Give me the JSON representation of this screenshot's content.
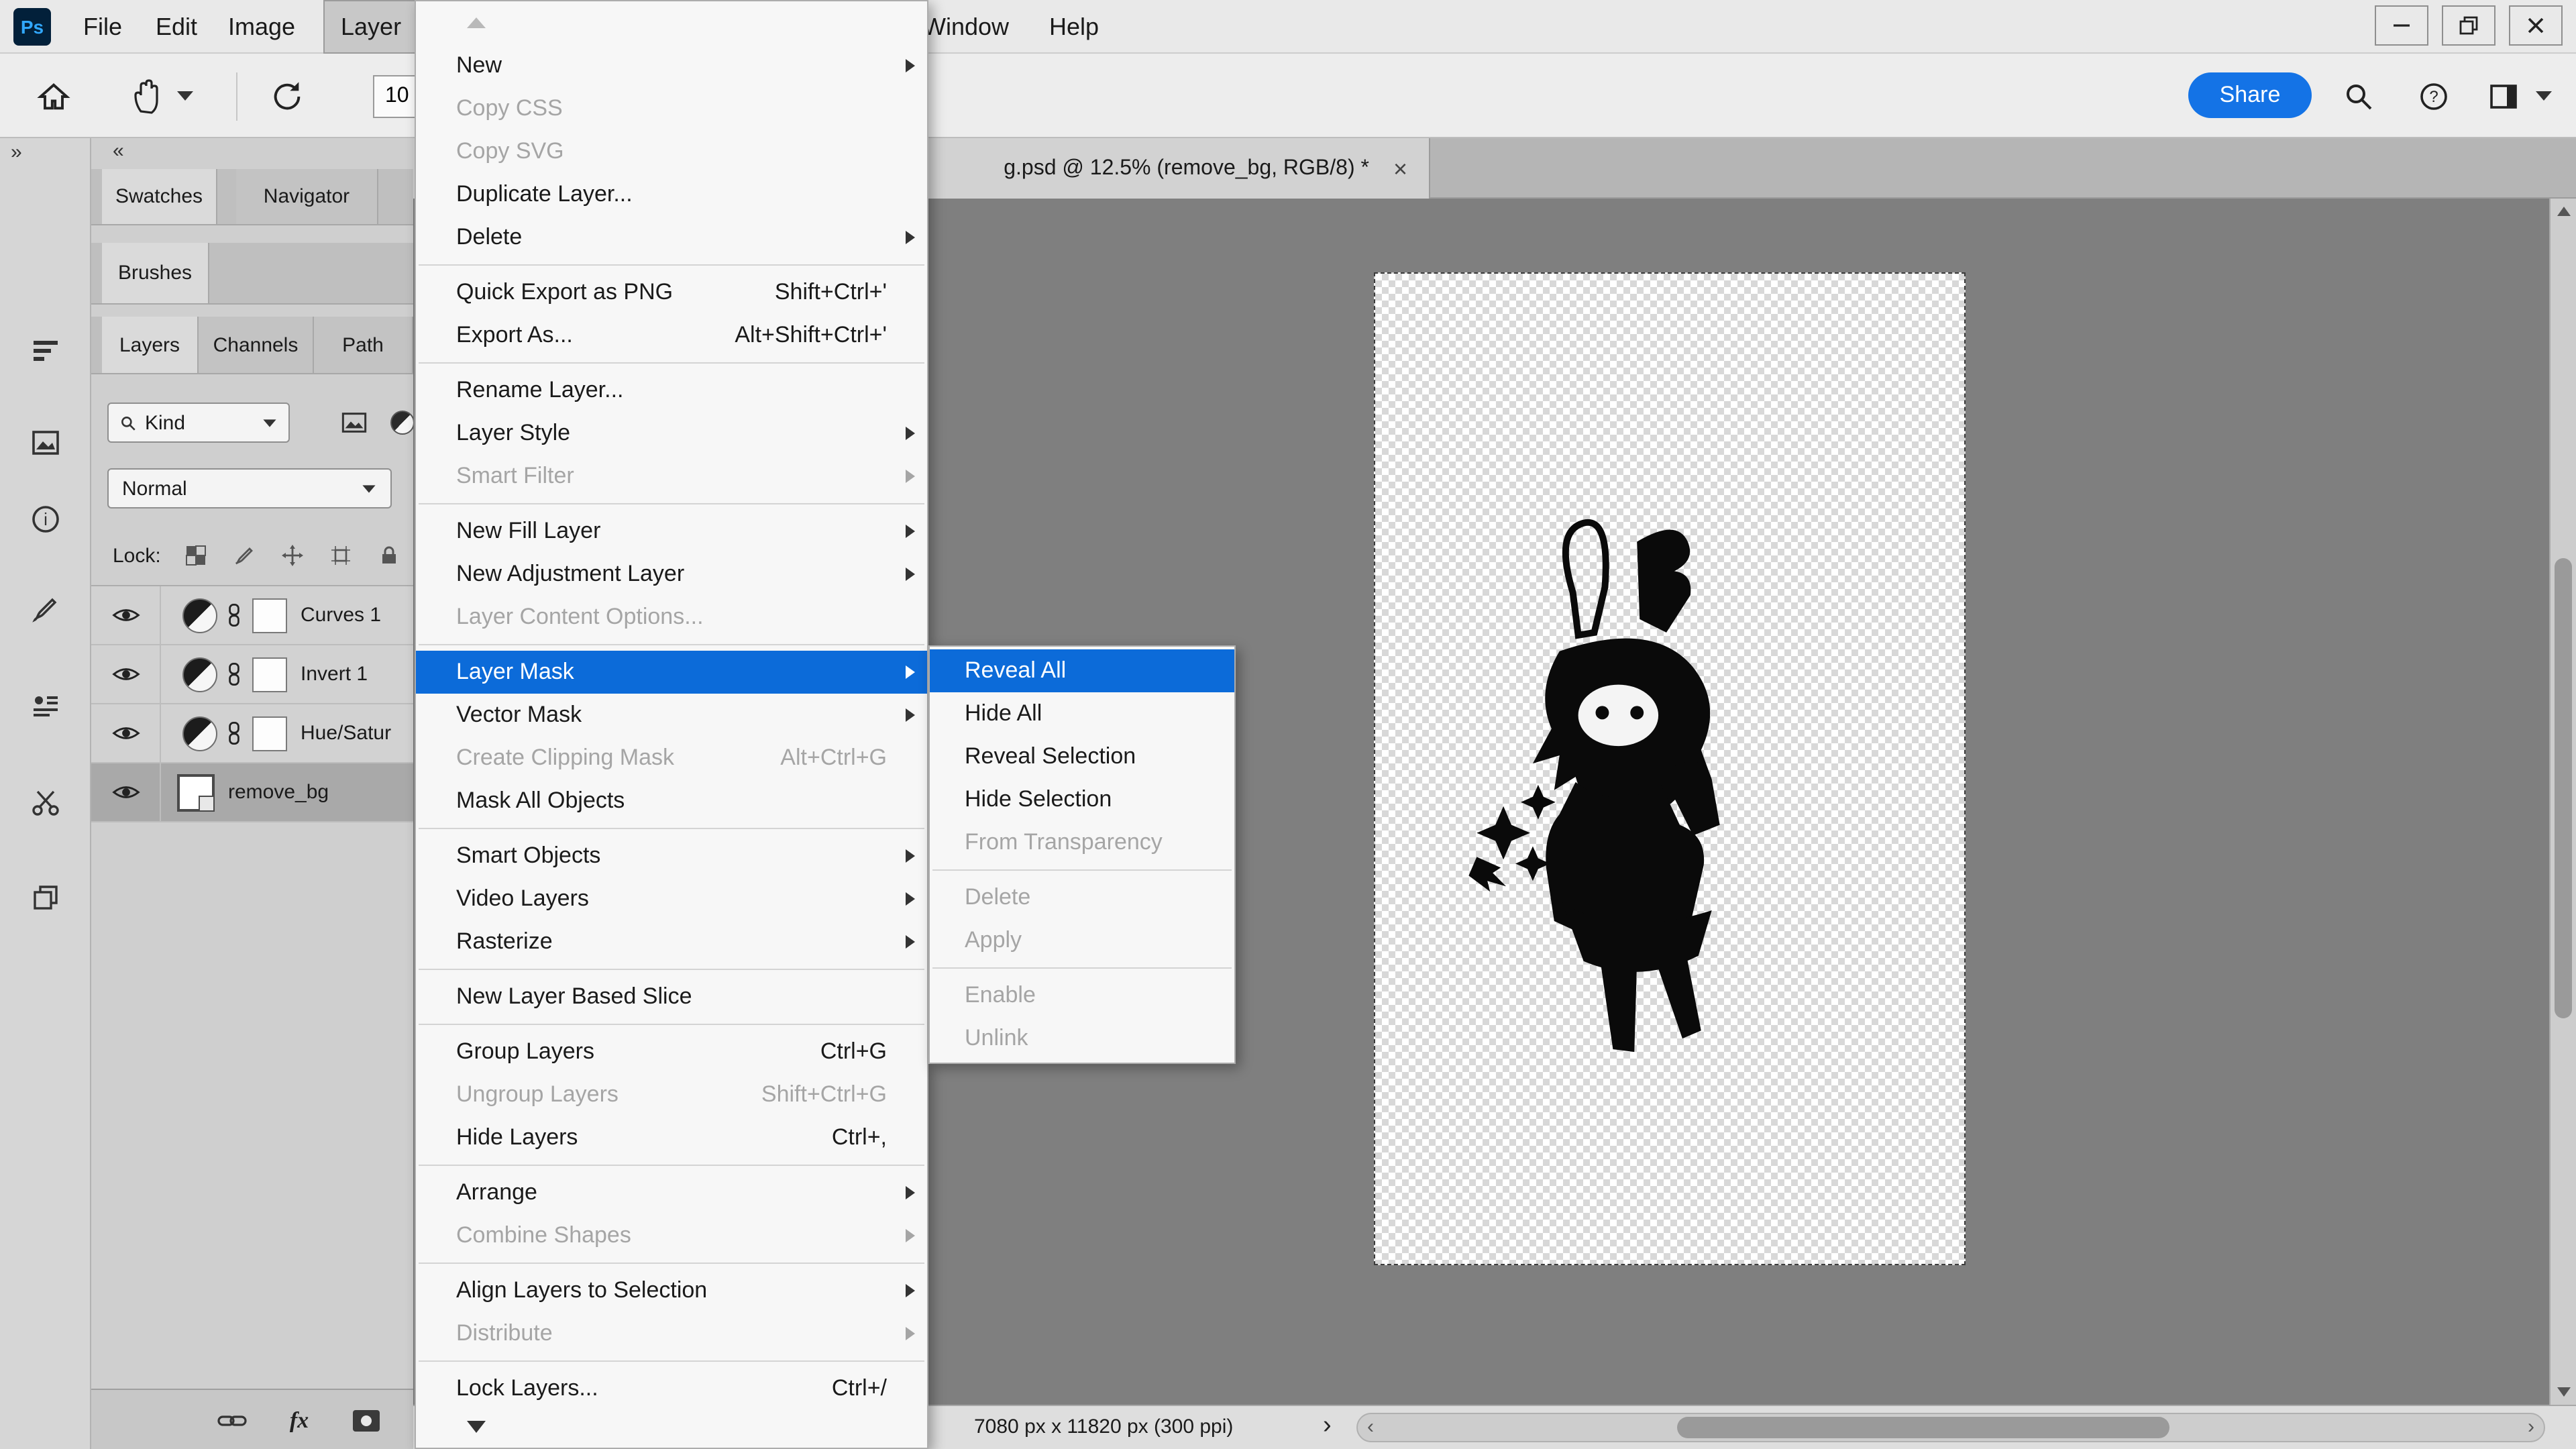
{
  "colors": {
    "accent": "#1473e6",
    "menu_highlight": "#0c6bd9",
    "canvas_bg": "#7f7f7f"
  },
  "menubar": {
    "logo": "Ps",
    "items": [
      {
        "label": "File"
      },
      {
        "label": "Edit"
      },
      {
        "label": "Image"
      },
      {
        "label": "Layer",
        "active": true
      },
      {
        "label": "Window"
      },
      {
        "label": "Help"
      }
    ]
  },
  "options_bar": {
    "rotation_value": "10",
    "share_label": "Share"
  },
  "document_tab": {
    "title": "g.psd @ 12.5% (remove_bg, RGB/8) *",
    "close": "×"
  },
  "panels": {
    "collapse_left": "«",
    "expand_right": "»",
    "tab_row1": [
      "Swatches",
      "Navigator"
    ],
    "tab_row2": [
      "Brushes"
    ],
    "tab_row3": [
      "Layers",
      "Channels",
      "Path"
    ],
    "kind_filter": "Kind",
    "blend_mode": "Normal",
    "lock_label": "Lock:",
    "layers": [
      {
        "name": "Curves 1",
        "kind": "adjustment",
        "visible": true,
        "selected": false
      },
      {
        "name": "Invert 1",
        "kind": "adjustment",
        "visible": true,
        "selected": false
      },
      {
        "name": "Hue/Satur",
        "kind": "adjustment",
        "visible": true,
        "selected": false
      },
      {
        "name": "remove_bg",
        "kind": "smart-object",
        "visible": true,
        "selected": true
      }
    ],
    "bottom_fx_label": "fx"
  },
  "layer_menu": {
    "items": [
      {
        "label": "New",
        "arrow": true
      },
      {
        "label": "Copy CSS",
        "disabled": true
      },
      {
        "label": "Copy SVG",
        "disabled": true
      },
      {
        "label": "Duplicate Layer..."
      },
      {
        "label": "Delete",
        "arrow": true
      },
      {
        "sep": true
      },
      {
        "label": "Quick Export as PNG",
        "shortcut": "Shift+Ctrl+'"
      },
      {
        "label": "Export As...",
        "shortcut": "Alt+Shift+Ctrl+'"
      },
      {
        "sep": true
      },
      {
        "label": "Rename Layer..."
      },
      {
        "label": "Layer Style",
        "arrow": true
      },
      {
        "label": "Smart Filter",
        "arrow": true,
        "disabled": true
      },
      {
        "sep": true
      },
      {
        "label": "New Fill Layer",
        "arrow": true
      },
      {
        "label": "New Adjustment Layer",
        "arrow": true
      },
      {
        "label": "Layer Content Options...",
        "disabled": true
      },
      {
        "sep": true
      },
      {
        "label": "Layer Mask",
        "arrow": true,
        "highlight": true
      },
      {
        "label": "Vector Mask",
        "arrow": true
      },
      {
        "label": "Create Clipping Mask",
        "shortcut": "Alt+Ctrl+G",
        "disabled": true
      },
      {
        "label": "Mask All Objects"
      },
      {
        "sep": true
      },
      {
        "label": "Smart Objects",
        "arrow": true
      },
      {
        "label": "Video Layers",
        "arrow": true
      },
      {
        "label": "Rasterize",
        "arrow": true
      },
      {
        "sep": true
      },
      {
        "label": "New Layer Based Slice"
      },
      {
        "sep": true
      },
      {
        "label": "Group Layers",
        "shortcut": "Ctrl+G"
      },
      {
        "label": "Ungroup Layers",
        "shortcut": "Shift+Ctrl+G",
        "disabled": true
      },
      {
        "label": "Hide Layers",
        "shortcut": "Ctrl+,"
      },
      {
        "sep": true
      },
      {
        "label": "Arrange",
        "arrow": true
      },
      {
        "label": "Combine Shapes",
        "arrow": true,
        "disabled": true
      },
      {
        "sep": true
      },
      {
        "label": "Align Layers to Selection",
        "arrow": true
      },
      {
        "label": "Distribute",
        "arrow": true,
        "disabled": true
      },
      {
        "sep": true
      },
      {
        "label": "Lock Layers...",
        "shortcut": "Ctrl+/"
      }
    ]
  },
  "layer_mask_submenu": {
    "items": [
      {
        "label": "Reveal All",
        "highlight": true
      },
      {
        "label": "Hide All"
      },
      {
        "label": "Reveal Selection"
      },
      {
        "label": "Hide Selection"
      },
      {
        "label": "From Transparency",
        "disabled": true
      },
      {
        "sep": true
      },
      {
        "label": "Delete",
        "disabled": true
      },
      {
        "label": "Apply",
        "disabled": true
      },
      {
        "sep": true
      },
      {
        "label": "Enable",
        "disabled": true
      },
      {
        "label": "Unlink",
        "disabled": true
      }
    ]
  },
  "status_bar": {
    "document_size": "7080 px x 11820 px (300 ppi)",
    "chevron": "›"
  }
}
